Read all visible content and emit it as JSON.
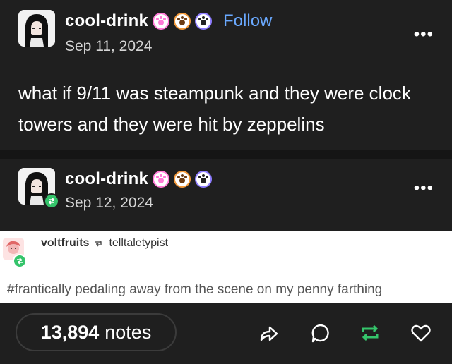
{
  "post": {
    "username": "cool-drink",
    "follow_label": "Follow",
    "date": "Sep 11, 2024",
    "more_label": "•••",
    "text": "what if 9/11 was steampunk and they were clock towers and they were hit by zeppelins"
  },
  "reblog": {
    "username": "cool-drink",
    "date": "Sep 12, 2024",
    "more_label": "•••"
  },
  "quoted": {
    "from_user": "voltfruits",
    "to_user": "telltaletypist",
    "hashtag": "#frantically pedaling away from the scene on my penny farthing"
  },
  "footer": {
    "notes_count": "13,894",
    "notes_label": "notes"
  },
  "icons": {
    "share": "share-icon",
    "reply": "reply-icon",
    "reblog": "reblog-icon",
    "like": "heart-icon"
  },
  "colors": {
    "background": "#1f1f1f",
    "follow": "#6aa9ff",
    "reblog_green": "#35c46b",
    "badge_pink": "#ff7ad6",
    "badge_orange": "#f39a3b",
    "badge_purple": "#8e7dff"
  }
}
